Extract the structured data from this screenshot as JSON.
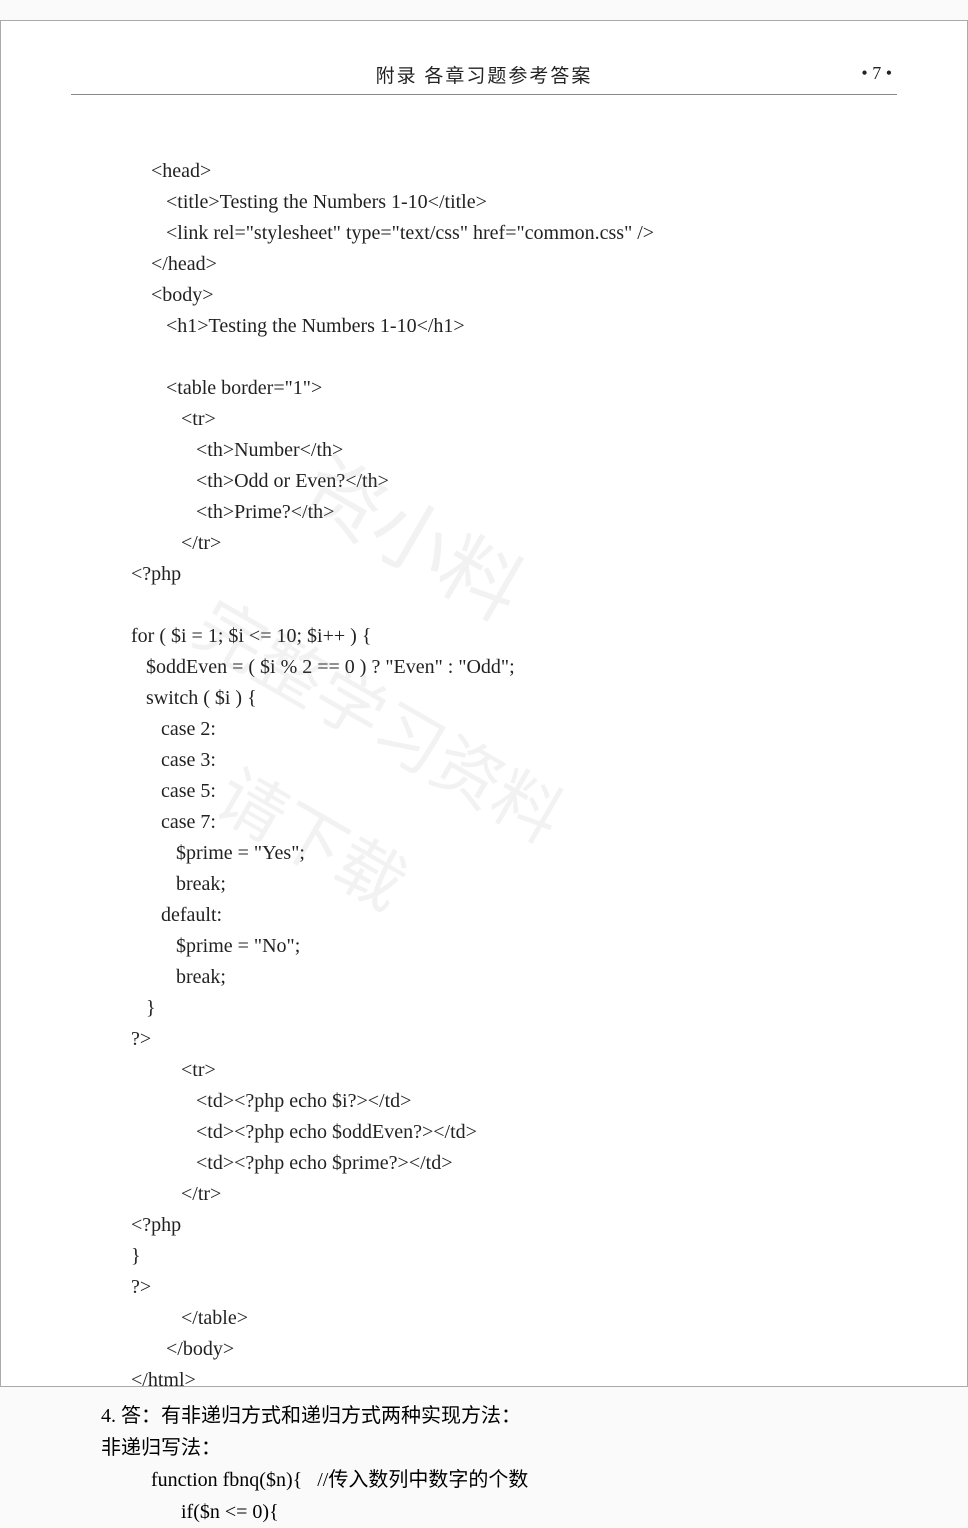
{
  "header": {
    "title": "附录    各章习题参考答案",
    "page_number": "• 7 •"
  },
  "code": {
    "line1": "<head>",
    "line2": "   <title>Testing the Numbers 1-10</title>",
    "line3": "   <link rel=\"stylesheet\" type=\"text/css\" href=\"common.css\" />",
    "line4": "</head>",
    "line5": "<body>",
    "line6": "   <h1>Testing the Numbers 1-10</h1>",
    "line7": "",
    "line8": "   <table border=\"1\">",
    "line9": "      <tr>",
    "line10": "         <th>Number</th>",
    "line11": "         <th>Odd or Even?</th>",
    "line12": "         <th>Prime?</th>",
    "line13": "      </tr>",
    "line14": "<?php",
    "line15": "",
    "line16": "for ( $i = 1; $i <= 10; $i++ ) {",
    "line17": "   $oddEven = ( $i % 2 == 0 ) ? \"Even\" : \"Odd\";",
    "line18": "   switch ( $i ) {",
    "line19": "      case 2:",
    "line20": "      case 3:",
    "line21": "      case 5:",
    "line22": "      case 7:",
    "line23": "         $prime = \"Yes\";",
    "line24": "         break;",
    "line25": "      default:",
    "line26": "         $prime = \"No\";",
    "line27": "         break;",
    "line28": "   }",
    "line29": "?>",
    "line30": "      <tr>",
    "line31": "         <td><?php echo $i?></td>",
    "line32": "         <td><?php echo $oddEven?></td>",
    "line33": "         <td><?php echo $prime?></td>",
    "line34": "      </tr>",
    "line35": "<?php",
    "line36": "}",
    "line37": "?>",
    "line38": "      </table>",
    "line39": "   </body>",
    "line40": "</html>"
  },
  "q4": {
    "line1": "4.  答：有非递归方式和递归方式两种实现方法：",
    "line2": "非递归写法：",
    "code1": "function fbnq($n){   //传入数列中数字的个数",
    "code2": "      if($n <= 0){"
  }
}
